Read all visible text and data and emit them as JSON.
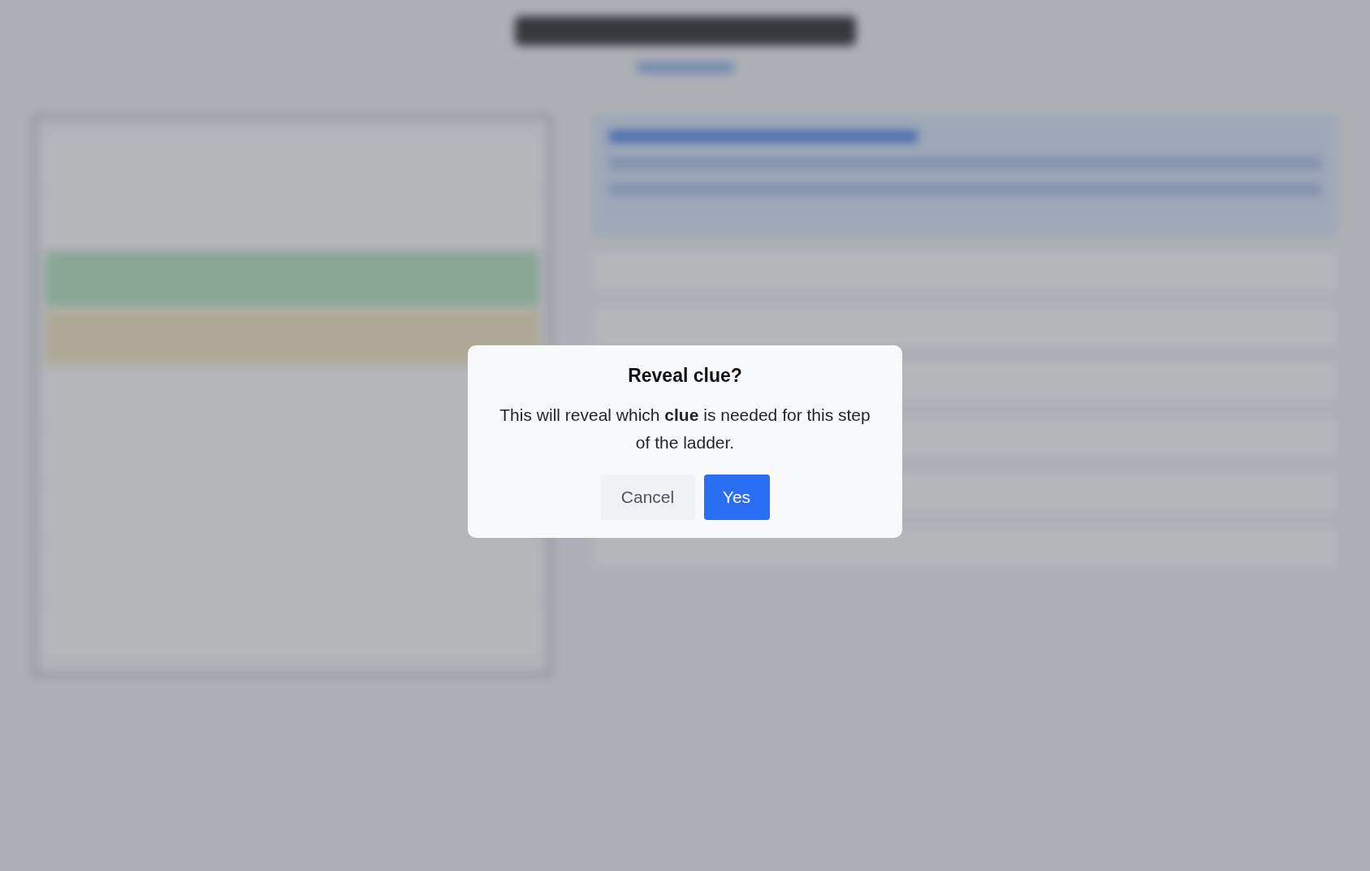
{
  "dialog": {
    "title": "Reveal clue?",
    "message": "This will reveal which **clue** is needed for this step of the ladder.",
    "buttons": [
      {
        "label": "Cancel",
        "kind": "secondary"
      },
      {
        "label": "Yes",
        "kind": "primary"
      }
    ]
  }
}
